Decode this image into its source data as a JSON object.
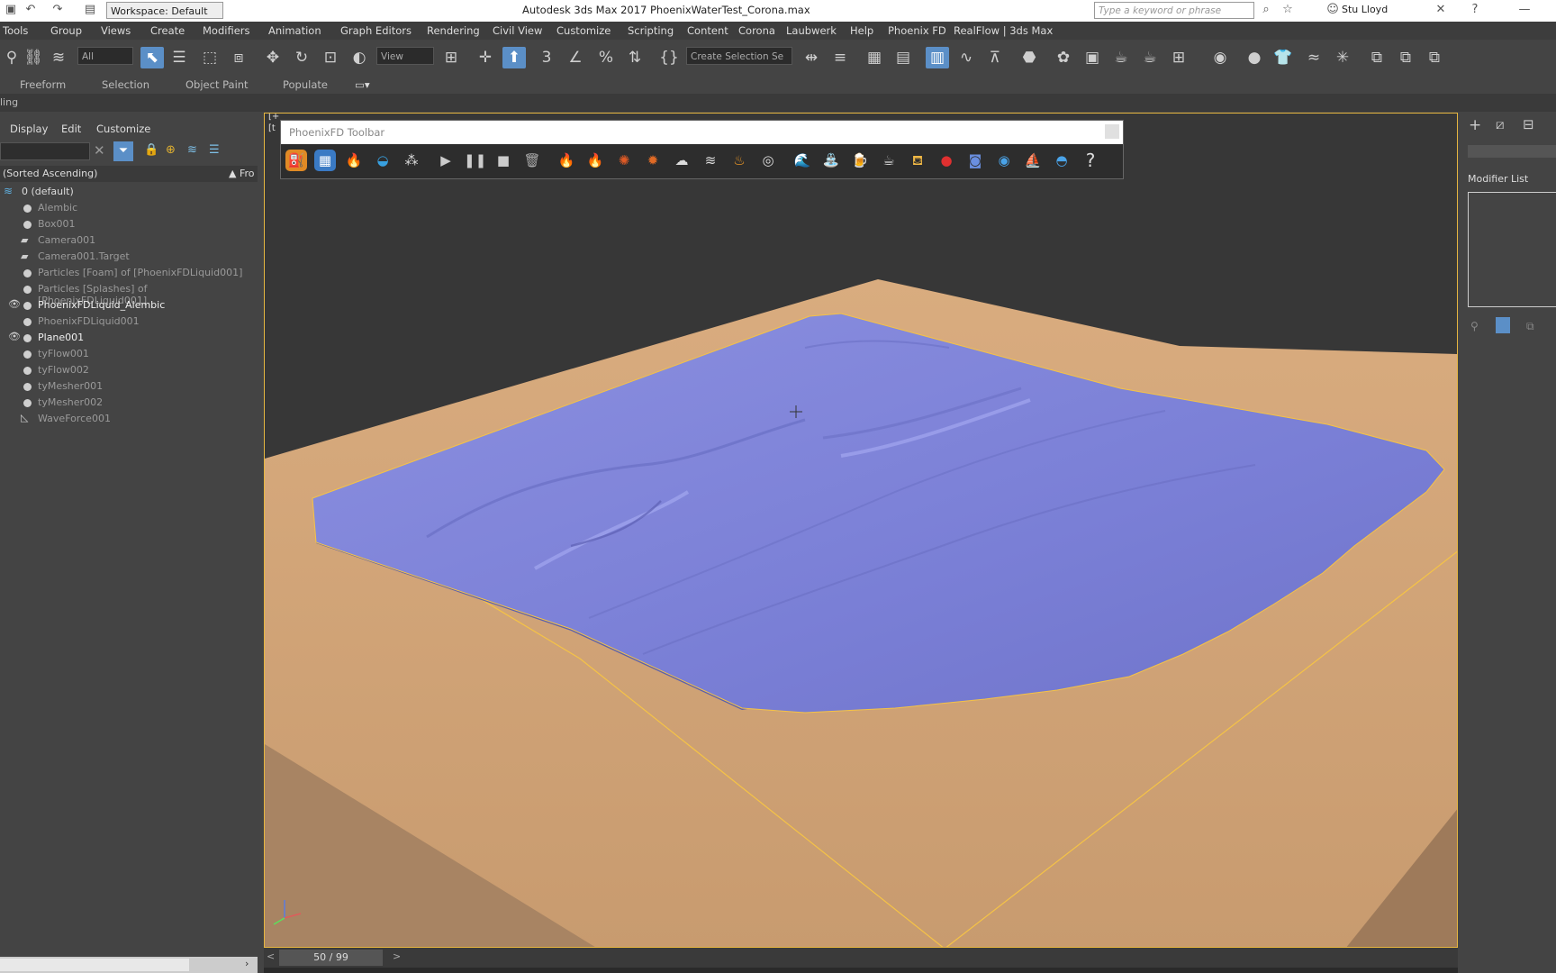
{
  "titlebar": {
    "workspace": "Workspace: Default",
    "title": "Autodesk 3ds Max 2017     PhoenixWaterTest_Corona.max",
    "search_placeholder": "Type a keyword or phrase",
    "user": "Stu Lloyd"
  },
  "menu": [
    "Tools",
    "Group",
    "Views",
    "Create",
    "Modifiers",
    "Animation",
    "Graph Editors",
    "Rendering",
    "Civil View",
    "Customize",
    "Scripting",
    "Content",
    "Corona",
    "Laubwerk",
    "Help",
    "Phoenix FD",
    "RealFlow | 3ds Max"
  ],
  "toolbar": {
    "selection_filter": "All",
    "ref_coord": "View",
    "named_selection": "Create Selection Se"
  },
  "ribbon": [
    "Freeform",
    "Selection",
    "Object Paint",
    "Populate"
  ],
  "ribbon2_label": "ling",
  "explorer": {
    "tabs": [
      "Display",
      "Edit",
      "Customize"
    ],
    "sort_label": "(Sorted Ascending)",
    "column_label": "▲ Fro",
    "layer": "0 (default)",
    "items": [
      {
        "name": "Alembic",
        "visible": false,
        "type": "object",
        "active": false
      },
      {
        "name": "Box001",
        "visible": false,
        "type": "object",
        "active": false
      },
      {
        "name": "Camera001",
        "visible": false,
        "type": "camera",
        "active": false
      },
      {
        "name": "Camera001.Target",
        "visible": false,
        "type": "camera",
        "active": false
      },
      {
        "name": "Particles [Foam] of [PhoenixFDLiquid001]",
        "visible": false,
        "type": "object",
        "active": false
      },
      {
        "name": "Particles [Splashes] of [PhoenixFDLiquid001]",
        "visible": false,
        "type": "object",
        "active": false
      },
      {
        "name": "PhoenixFDLiquid_Alembic",
        "visible": true,
        "type": "object",
        "active": true
      },
      {
        "name": "PhoenixFDLiquid001",
        "visible": false,
        "type": "object",
        "active": false
      },
      {
        "name": "Plane001",
        "visible": true,
        "type": "object",
        "active": true
      },
      {
        "name": "tyFlow001",
        "visible": false,
        "type": "object",
        "active": false
      },
      {
        "name": "tyFlow002",
        "visible": false,
        "type": "object",
        "active": false
      },
      {
        "name": "tyMesher001",
        "visible": false,
        "type": "object",
        "active": false
      },
      {
        "name": "tyMesher002",
        "visible": false,
        "type": "object",
        "active": false
      },
      {
        "name": "WaveForce001",
        "visible": false,
        "type": "force",
        "active": false
      }
    ]
  },
  "viewport": {
    "label_plus": "[+",
    "label_b": "[t",
    "colors": {
      "ground": "#d9ac7f",
      "ground_side": "#a88463",
      "water": "#7f84d8",
      "water_dark": "#5d62b0",
      "selection": "#f5c346",
      "bg": "#373737"
    }
  },
  "phoenix_toolbar": {
    "title": "PhoenixFD Toolbar",
    "help": "?"
  },
  "cmdpanel": {
    "modifier_list": "Modifier List"
  },
  "timeline": {
    "frame": "50 / 99",
    "prev": "<",
    "next": ">"
  }
}
